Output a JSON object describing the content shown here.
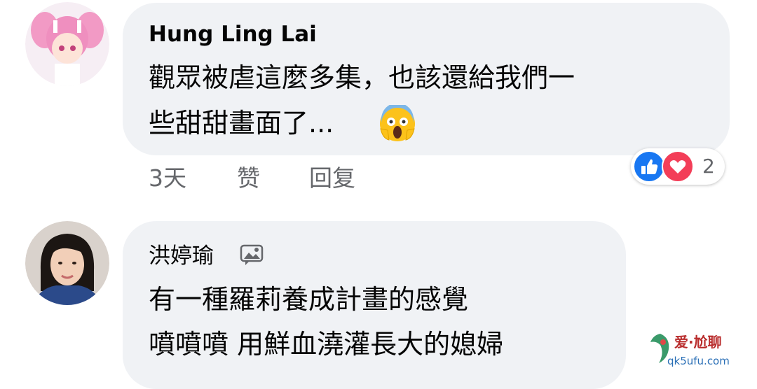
{
  "comments": [
    {
      "author": "Hung Ling Lai",
      "avatar": "anime-avatar",
      "text_lines": [
        "觀眾被虐這麼多集，也該還給我們一",
        "些甜甜畫面了..."
      ],
      "emoji": "screaming-face-emoji",
      "meta": {
        "time": "3天",
        "like": "赞",
        "reply": "回复"
      },
      "reactions": {
        "types": [
          "like",
          "love"
        ],
        "count": "2"
      }
    },
    {
      "author": "洪婷瑜",
      "avatar": "woman-photo-avatar",
      "badge": "image-badge-icon",
      "text_lines": [
        "有一種羅莉養成計畫的感覺",
        "噴噴噴 用鮮血澆灌長大的媳婦"
      ]
    }
  ],
  "watermark": {
    "brand": "爱·尬聊",
    "url": "qk5ufu.com"
  },
  "colors": {
    "bubble": "#f0f2f5",
    "text": "#050505",
    "meta": "#65676b",
    "like": "#1877f2",
    "love": "#f33e58"
  }
}
